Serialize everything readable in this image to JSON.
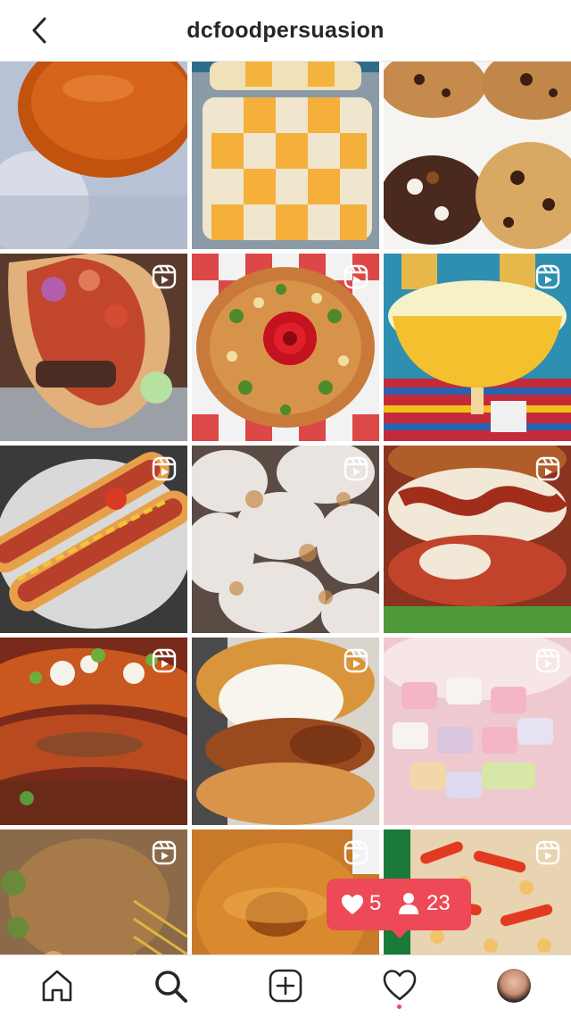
{
  "header": {
    "title": "dcfoodpersuasion",
    "back_icon": "chevron-left-icon"
  },
  "grid": {
    "tiles": [
      {
        "subject": "flan",
        "is_reel": false
      },
      {
        "subject": "checkerboard cheesecake bars",
        "is_reel": false
      },
      {
        "subject": "chocolate chip cookies",
        "is_reel": false
      },
      {
        "subject": "gyro wrap",
        "is_reel": true
      },
      {
        "subject": "birria tacos with rose",
        "is_reel": true
      },
      {
        "subject": "mango margarita",
        "is_reel": true
      },
      {
        "subject": "hot dogs in sesame buns",
        "is_reel": true
      },
      {
        "subject": "powdered sugar beignets",
        "is_reel": true
      },
      {
        "subject": "bacon cheese burger",
        "is_reel": true
      },
      {
        "subject": "quesabirria tacos",
        "is_reel": true
      },
      {
        "subject": "fried chicken sandwich",
        "is_reel": true
      },
      {
        "subject": "marshmallows",
        "is_reel": true
      },
      {
        "subject": "hibachi platter",
        "is_reel": true
      },
      {
        "subject": "glazed donut",
        "is_reel": true
      },
      {
        "subject": "candy mix",
        "is_reel": true
      }
    ]
  },
  "notification": {
    "likes": "5",
    "follows": "23",
    "like_icon": "heart-icon",
    "follow_icon": "person-icon",
    "color": "#ed4956"
  },
  "tabbar": {
    "tabs": [
      {
        "name": "home",
        "icon": "home-icon"
      },
      {
        "name": "search",
        "icon": "search-icon"
      },
      {
        "name": "new post",
        "icon": "add-post-icon"
      },
      {
        "name": "activity",
        "icon": "heart-outline-icon"
      },
      {
        "name": "profile",
        "icon": "avatar"
      }
    ]
  }
}
